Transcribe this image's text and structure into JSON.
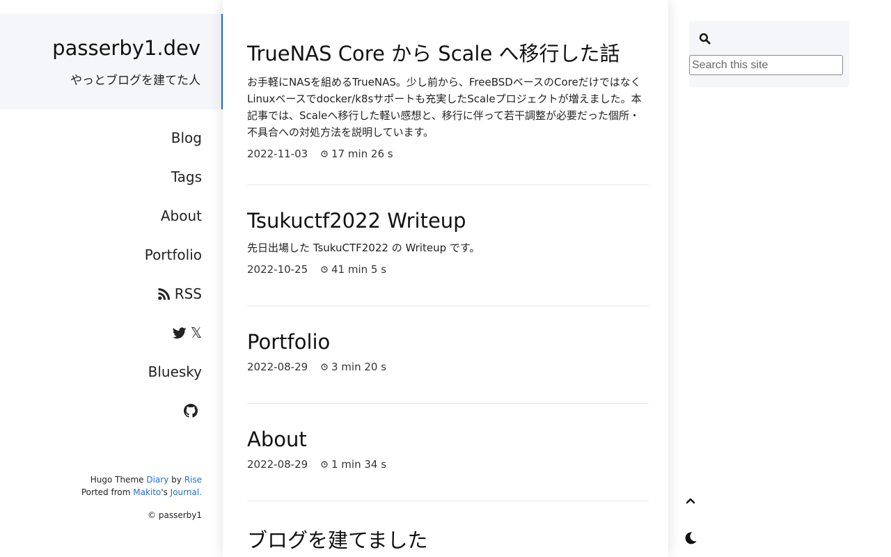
{
  "site": {
    "title": "passerby1.dev",
    "subtitle": "やっとブログを建てた人"
  },
  "nav": {
    "items": [
      {
        "label": "Blog"
      },
      {
        "label": "Tags"
      },
      {
        "label": "About"
      },
      {
        "label": "Portfolio"
      },
      {
        "label": "RSS",
        "icon": "rss-icon"
      },
      {
        "label": "𝕏",
        "icon": "twitter-icon"
      },
      {
        "label": "Bluesky"
      },
      {
        "label": "",
        "icon": "github-icon"
      }
    ]
  },
  "footer": {
    "hugo_theme": "Hugo Theme",
    "theme_name": "Diary",
    "by": "by",
    "author": "Rise",
    "ported_from": "Ported from",
    "ported_author": "Makito",
    "possessive": "'s",
    "journal": "Journal.",
    "copyright": "© passerby1"
  },
  "posts": [
    {
      "title": "TrueNAS Core から Scale へ移行した話",
      "excerpt": "お手軽にNASを組めるTrueNAS。少し前から、FreeBSDベースのCoreだけではなくLinuxベースでdocker/k8sサポートも充実したScaleプロジェクトが増えました。本記事では、Scaleへ移行した軽い感想と、移行に伴って若干調整が必要だった個所・不具合への対処方法を説明しています。",
      "date": "2022-11-03",
      "reading_time": "17 min 26 s"
    },
    {
      "title": "Tsukuctf2022 Writeup",
      "excerpt": "先日出場した TsukuCTF2022 の Writeup です。",
      "date": "2022-10-25",
      "reading_time": "41 min 5 s"
    },
    {
      "title": "Portfolio",
      "excerpt": "",
      "date": "2022-08-29",
      "reading_time": "3 min 20 s"
    },
    {
      "title": "About",
      "excerpt": "",
      "date": "2022-08-29",
      "reading_time": "1 min 34 s"
    },
    {
      "title": "ブログを建てました",
      "excerpt": "",
      "date": "",
      "reading_time": ""
    }
  ],
  "search": {
    "placeholder": "Search this site"
  },
  "icons": {
    "search": "search-icon",
    "clock": "clock-icon",
    "back_to_top": "chevron-up-icon",
    "dark_mode": "moon-icon"
  },
  "colors": {
    "accent": "#1e6fd9",
    "panel_bg": "#f5f6fa"
  }
}
